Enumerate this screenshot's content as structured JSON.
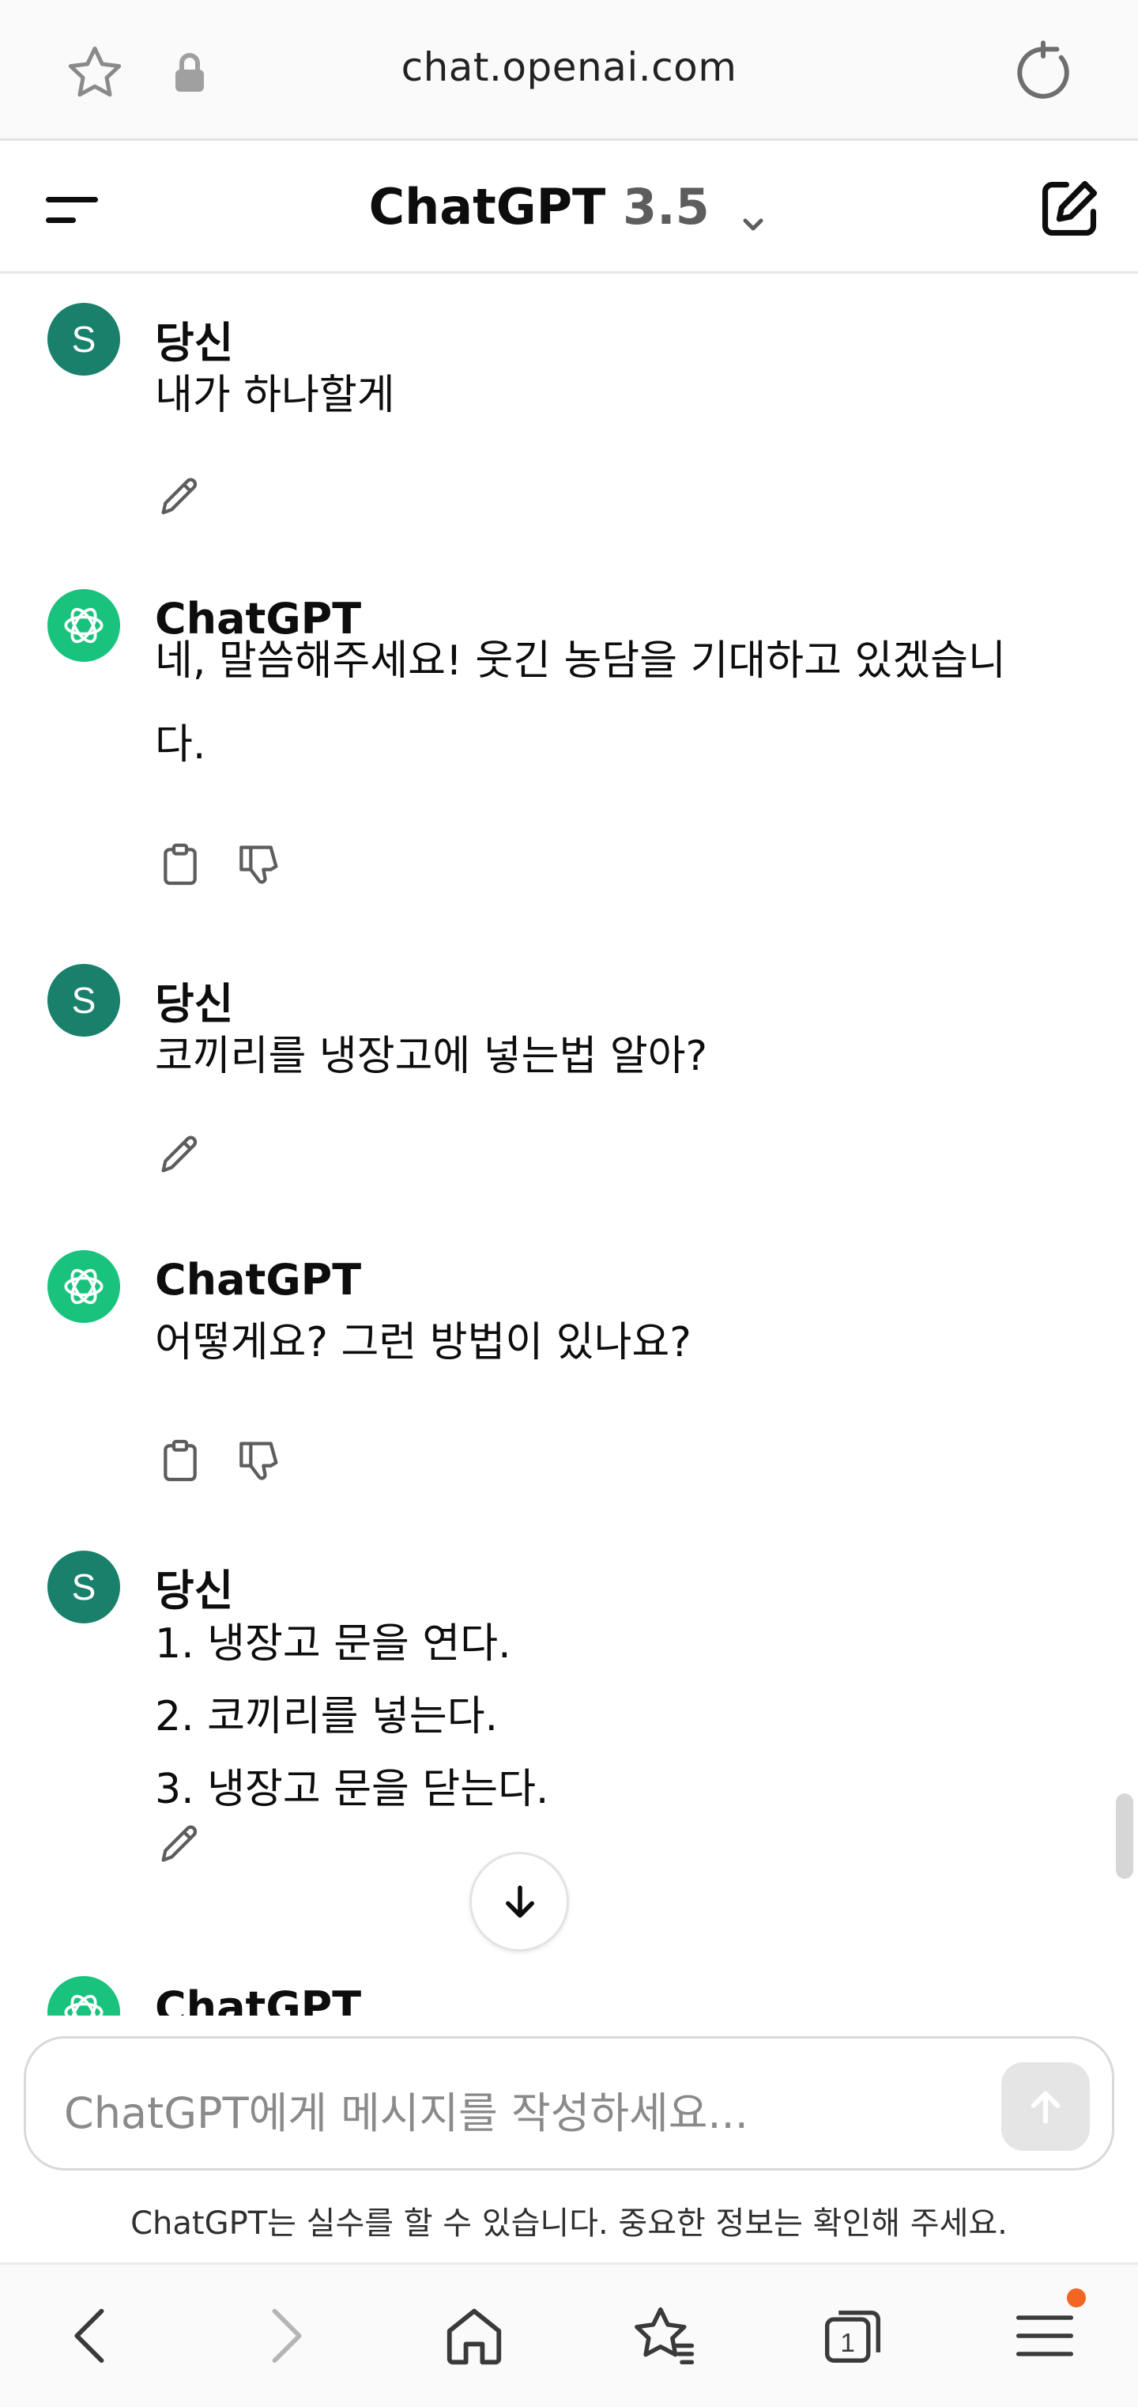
{
  "browser": {
    "url": "chat.openai.com"
  },
  "header": {
    "title": "ChatGPT",
    "version": "3.5"
  },
  "conversation": [
    {
      "role": "user",
      "avatar": "S",
      "author": "당신",
      "lines": [
        "내가 하나할게"
      ]
    },
    {
      "role": "assistant",
      "author": "ChatGPT",
      "lines": [
        "네, 말씀해주세요! 웃긴 농담을 기대하고 있겠습니",
        "다."
      ]
    },
    {
      "role": "user",
      "avatar": "S",
      "author": "당신",
      "lines": [
        "코끼리를 냉장고에 넣는법 알아?"
      ]
    },
    {
      "role": "assistant",
      "author": "ChatGPT",
      "lines": [
        "어떻게요? 그런 방법이 있나요?"
      ]
    },
    {
      "role": "user",
      "avatar": "S",
      "author": "당신",
      "lines": [
        "1. 냉장고 문을 연다.",
        "2. 코끼리를 넣는다.",
        "3. 냉장고 문을 닫는다."
      ]
    },
    {
      "role": "assistant",
      "author": "ChatGPT",
      "lines": []
    }
  ],
  "composer": {
    "placeholder": "ChatGPT에게 메시지를 작성하세요...",
    "disclaimer": "ChatGPT는 실수를 할 수 있습니다. 중요한 정보는 확인해 주세요."
  },
  "bottom_nav": {
    "tab_count": "1",
    "menu_has_notification": true
  },
  "colors": {
    "user_avatar": "#19806b",
    "assistant_avatar": "#19c37d",
    "notification_badge": "#f26522"
  }
}
